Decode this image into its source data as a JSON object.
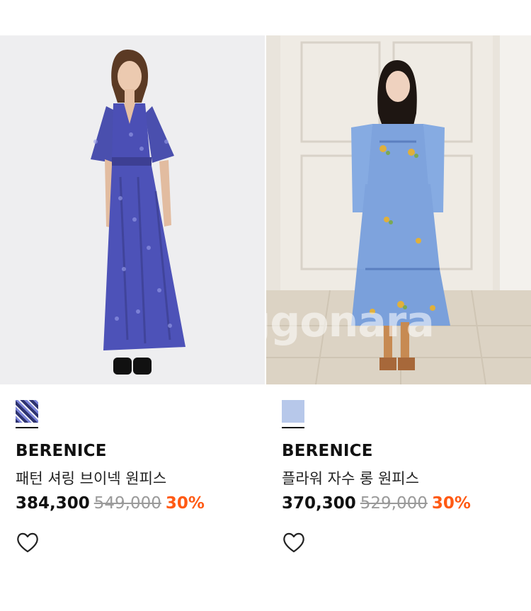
{
  "products": [
    {
      "brand": "BERENICE",
      "name": "패턴 셔링 브이넥 원피스",
      "price": "384,300",
      "original_price": "549,000",
      "discount": "30%",
      "swatch_color": "#3a3f8a",
      "image_alt": "blue floral maxi dress"
    },
    {
      "brand": "BERENICE",
      "name": "플라워 자수 롱 원피스",
      "price": "370,300",
      "original_price": "529,000",
      "discount": "30%",
      "swatch_color": "#b7c8ea",
      "image_alt": "light blue embroidered long dress"
    }
  ],
  "watermark": "Joonggonara",
  "colors": {
    "discount": "#ff5a14",
    "strike": "#9a9a9a"
  },
  "icons": {
    "like": "heart-outline-icon"
  }
}
